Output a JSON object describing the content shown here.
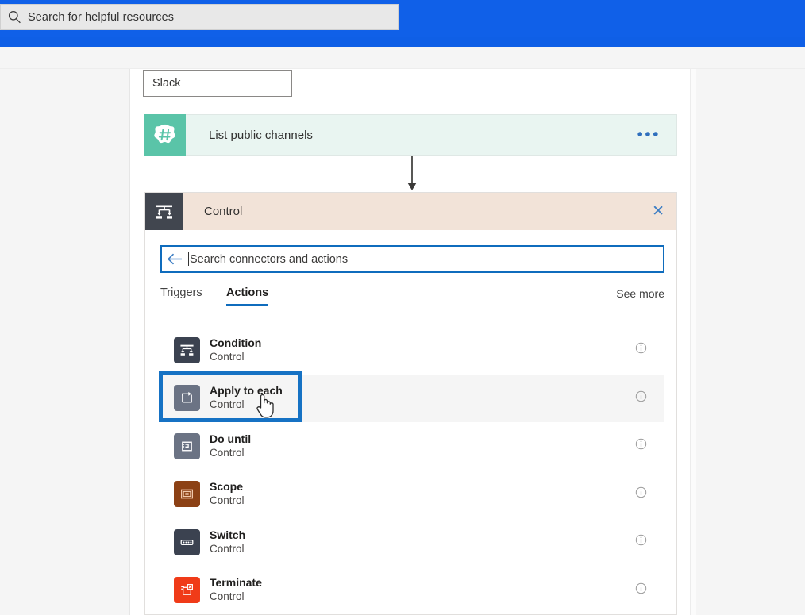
{
  "topbar": {
    "search_placeholder": "Search for helpful resources",
    "search_icon": "search-icon",
    "accent_color": "#1060e8"
  },
  "canvas": {
    "connection_name": "Slack",
    "action_card": {
      "title": "List public channels",
      "icon": "slack-hash-icon",
      "icon_bg": "#5ac4a8",
      "card_bg": "#e9f5f1",
      "overflow_label": "•••"
    },
    "connector_icon": "down-arrow-icon"
  },
  "control_panel": {
    "header": {
      "title": "Control",
      "icon": "control-condition-icon",
      "icon_bg": "#41464f",
      "header_bg": "#f2e3d8",
      "close_label": "✕"
    },
    "search": {
      "placeholder": "Search connectors and actions",
      "back_icon": "back-arrow-icon",
      "border_color": "#0f6cbd"
    },
    "tabs": [
      {
        "label": "Triggers",
        "selected": false
      },
      {
        "label": "Actions",
        "selected": true
      }
    ],
    "see_more_label": "See more",
    "actions": [
      {
        "title": "Condition",
        "subtitle": "Control",
        "icon": "condition-icon",
        "icon_bg": "#3b4250",
        "selected": false
      },
      {
        "title": "Apply to each",
        "subtitle": "Control",
        "icon": "apply-to-each-icon",
        "icon_bg": "#6b7384",
        "selected": true
      },
      {
        "title": "Do until",
        "subtitle": "Control",
        "icon": "do-until-icon",
        "icon_bg": "#6b7384",
        "selected": false
      },
      {
        "title": "Scope",
        "subtitle": "Control",
        "icon": "scope-icon",
        "icon_bg": "#8c4115",
        "selected": false
      },
      {
        "title": "Switch",
        "subtitle": "Control",
        "icon": "switch-icon",
        "icon_bg": "#3b4250",
        "selected": false
      },
      {
        "title": "Terminate",
        "subtitle": "Control",
        "icon": "terminate-icon",
        "icon_bg": "#f03b18",
        "selected": false
      }
    ],
    "info_icon": "info-icon",
    "highlight_color": "#1672c4"
  }
}
